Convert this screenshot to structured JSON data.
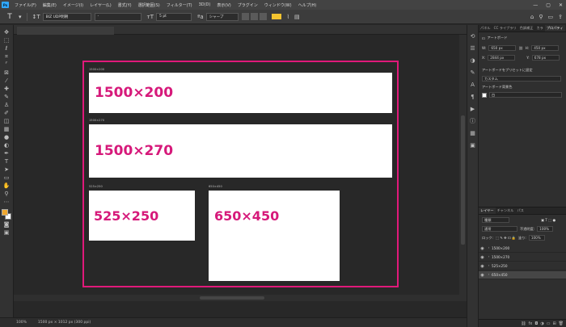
{
  "menu": {
    "items": [
      "ファイル(F)",
      "編集(E)",
      "イメージ(I)",
      "レイヤー(L)",
      "書式(Y)",
      "選択範囲(S)",
      "フィルター(T)",
      "3D(D)",
      "表示(V)",
      "プラグイン",
      "ウィンドウ(W)",
      "ヘルプ(H)"
    ],
    "app_badge": "Ps"
  },
  "options": {
    "font_family": "BIZ UDP明朝",
    "font_style": "-",
    "font_size": "5 pt",
    "antialias": "シャープ",
    "text_color": "#f4c430"
  },
  "artboards": [
    {
      "label": "1500×200",
      "dim": "1500×200"
    },
    {
      "label": "1500×270",
      "dim": "1500×270"
    },
    {
      "label": "525×250",
      "dim": "525×250"
    },
    {
      "label": "650×450",
      "dim": "650×450"
    }
  ],
  "status": {
    "zoom": "100%",
    "doc_size": "1500 px × 1012 px (300 ppi)"
  },
  "panels": {
    "tabs": [
      "パネル",
      "CC ライブラリ",
      "色調補正",
      "カラ",
      "プロパティ"
    ],
    "active_tab": "プロパティ",
    "section": "アートボード",
    "w_label": "W:",
    "w_value": "650 px",
    "h_label": "H:",
    "h_value": "450 px",
    "x_label": "X:",
    "x_value": "2844 px",
    "y_label": "Y:",
    "y_value": "678 px",
    "preset_label": "アートボードをプリセットに設定",
    "preset_value": "カスタム",
    "bg_label": "アートボード背景色",
    "bg_value": "白"
  },
  "layers_panel": {
    "tabs": [
      "レイヤー",
      "チャンネル",
      "パス"
    ],
    "filter": "種類",
    "blend_mode": "通常",
    "opacity_label": "不透明度:",
    "opacity": "100%",
    "lock_label": "ロック:",
    "fill_label": "塗り:",
    "fill": "100%",
    "items": [
      "1500×200",
      "1500×270",
      "525×250",
      "650×450"
    ]
  },
  "colors": {
    "accent_magenta": "#e0197a",
    "foreground": "#f0a830",
    "background": "#ffffff"
  }
}
